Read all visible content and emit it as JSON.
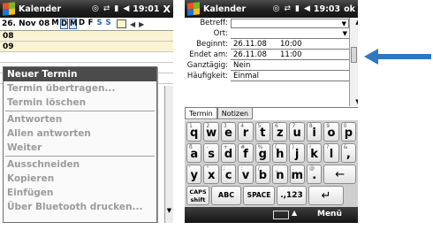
{
  "left": {
    "app_title": "Kalender",
    "time": "19:01",
    "close_label": "X",
    "date_label": "26. Nov 08",
    "days": [
      "M",
      "D",
      "M",
      "D",
      "F",
      "S",
      "S"
    ],
    "hours": [
      "08",
      "09"
    ],
    "menu_items": [
      {
        "label": "Neuer Termin",
        "state": "active"
      },
      {
        "label": "Termin übertragen...",
        "state": "disabled"
      },
      {
        "label": "Termin löschen",
        "state": "disabled"
      },
      {
        "label": "Antworten",
        "state": "disabled"
      },
      {
        "label": "Allen antworten",
        "state": "disabled"
      },
      {
        "label": "Weiter",
        "state": "disabled"
      },
      {
        "label": "Ausschneiden",
        "state": "disabled"
      },
      {
        "label": "Kopieren",
        "state": "disabled"
      },
      {
        "label": "Einfügen",
        "state": "disabled"
      },
      {
        "label": "Über Bluetooth drucken...",
        "state": "disabled"
      }
    ]
  },
  "right": {
    "app_title": "Kalender",
    "time": "19:03",
    "ok_label": "ok",
    "fields": {
      "betreff_label": "Betreff:",
      "ort_label": "Ort:",
      "beginnt_label": "Beginnt:",
      "beginnt_date": "26.11.08",
      "beginnt_time": "10:00",
      "endet_label": "Endet am:",
      "endet_date": "26.11.08",
      "endet_time": "11:00",
      "ganztaegig_label": "Ganztägig:",
      "ganztaegig_value": "Nein",
      "haeufigkeit_label": "Häufigkeit:",
      "haeufigkeit_value": "Einmal"
    },
    "tabs": [
      "Termin",
      "Notizen"
    ],
    "keyboard": {
      "row1": [
        {
          "main": "q",
          "sec": "1"
        },
        {
          "main": "w",
          "sec": "2"
        },
        {
          "main": "e",
          "sec": "3"
        },
        {
          "main": "r",
          "sec": "4"
        },
        {
          "main": "t",
          "sec": "5"
        },
        {
          "main": "z",
          "sec": "6"
        },
        {
          "main": "u",
          "sec": "7"
        },
        {
          "main": "i",
          "sec": "8"
        },
        {
          "main": "o",
          "sec": "9"
        },
        {
          "main": "p",
          "sec": "0"
        }
      ],
      "row2": [
        {
          "main": "a",
          "sec": "ß"
        },
        {
          "main": "s",
          "sec": "-"
        },
        {
          "main": "d",
          "sec": "+"
        },
        {
          "main": "f",
          "sec": "#"
        },
        {
          "main": "g",
          "sec": "%"
        },
        {
          "main": "h",
          "sec": "("
        },
        {
          "main": "j",
          "sec": ")"
        },
        {
          "main": "k",
          "sec": "!"
        },
        {
          "main": "l",
          "sec": "?"
        },
        {
          "main": ",",
          "sec": "&"
        }
      ],
      "row3": [
        {
          "main": "y",
          "sec": "'"
        },
        {
          "main": "x",
          "sec": "\""
        },
        {
          "main": "c",
          "sec": ";"
        },
        {
          "main": "v",
          "sec": ":"
        },
        {
          "main": "b",
          "sec": "/"
        },
        {
          "main": "n",
          "sec": "_"
        },
        {
          "main": "m",
          "sec": "."
        },
        {
          "main": ".",
          "sec": "@"
        }
      ],
      "caps_label": "CAPS shift",
      "abc_label": "ABC",
      "space_label": "SPACE",
      "num_label": ".,123"
    },
    "softkey_menu": "Menü"
  },
  "colors": {
    "titlebar": "#202020",
    "menu_active": "#4b4b4b",
    "pointer_arrow": "#2e78c2",
    "hour_fill": "#fbf4d3"
  }
}
